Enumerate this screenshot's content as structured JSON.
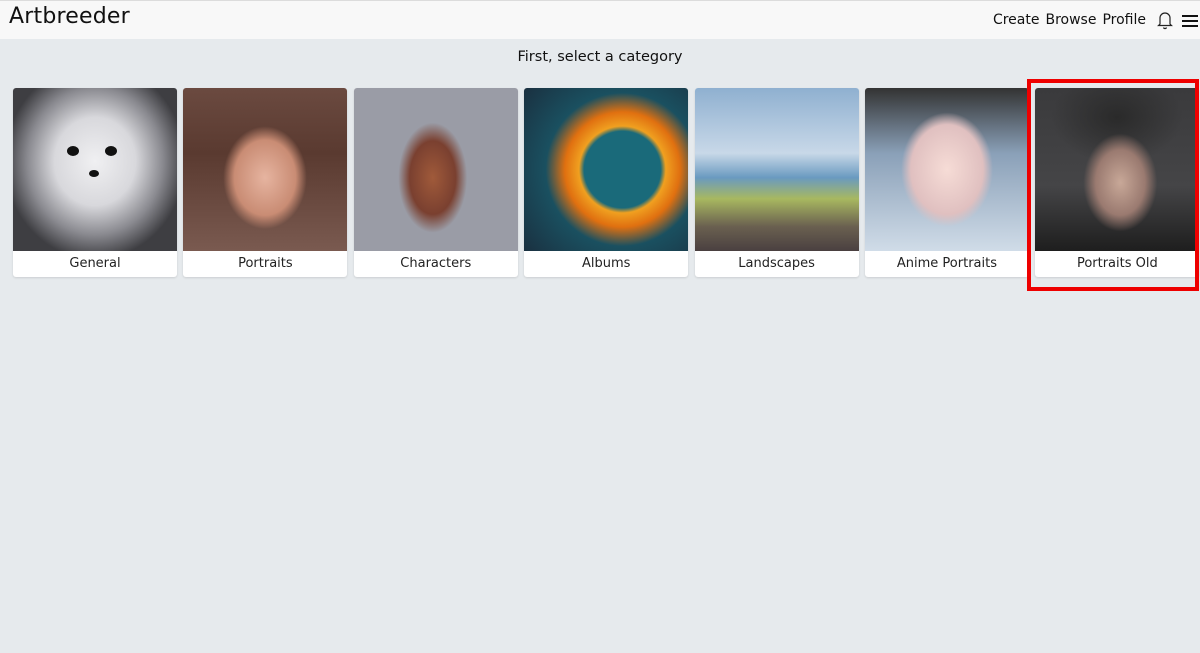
{
  "app": {
    "title": "Artbreeder"
  },
  "nav": {
    "items": [
      {
        "label": "Create"
      },
      {
        "label": "Browse"
      },
      {
        "label": "Profile"
      }
    ],
    "icons": [
      "bell-icon",
      "hamburger-menu-icon"
    ]
  },
  "main": {
    "heading": "First, select a category",
    "categories": [
      {
        "label": "General",
        "image": "fluffy white dog"
      },
      {
        "label": "Portraits",
        "image": "painted portrait of woman"
      },
      {
        "label": "Characters",
        "image": "fantasy warrior character"
      },
      {
        "label": "Albums",
        "image": "album cover art"
      },
      {
        "label": "Landscapes",
        "image": "lake landscape with rock figure"
      },
      {
        "label": "Anime Portraits",
        "image": "anime girl portrait"
      },
      {
        "label": "Portraits Old",
        "image": "portrait with short dark hair"
      }
    ],
    "highlighted_category": "Portraits Old",
    "highlight_color": "#ee0000"
  }
}
